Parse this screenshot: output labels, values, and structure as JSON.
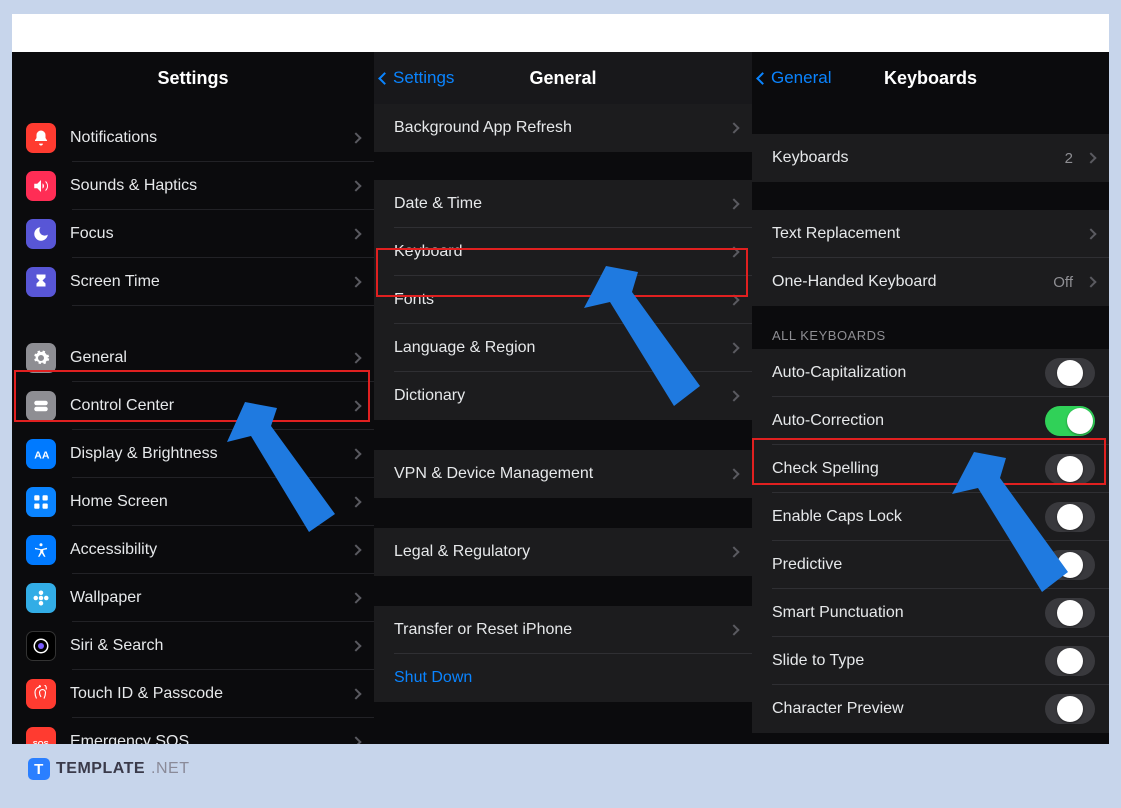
{
  "panel1": {
    "title": "Settings",
    "items_top": [
      {
        "label": "Notifications",
        "icon": "bell-icon",
        "color": "ic-red"
      },
      {
        "label": "Sounds & Haptics",
        "icon": "speaker-icon",
        "color": "ic-pink"
      },
      {
        "label": "Focus",
        "icon": "moon-icon",
        "color": "ic-indigo"
      },
      {
        "label": "Screen Time",
        "icon": "hourglass-icon",
        "color": "ic-indigo"
      }
    ],
    "items_mid": [
      {
        "label": "General",
        "icon": "gear-icon",
        "color": "ic-grey",
        "highlight": true
      },
      {
        "label": "Control Center",
        "icon": "switches-icon",
        "color": "ic-grey"
      },
      {
        "label": "Display & Brightness",
        "icon": "aa-icon",
        "color": "ic-blue"
      },
      {
        "label": "Home Screen",
        "icon": "grid-icon",
        "color": "ic-blue2"
      },
      {
        "label": "Accessibility",
        "icon": "accessibility-icon",
        "color": "ic-blue"
      },
      {
        "label": "Wallpaper",
        "icon": "flower-icon",
        "color": "ic-cyan"
      },
      {
        "label": "Siri & Search",
        "icon": "siri-icon",
        "color": "ic-black"
      },
      {
        "label": "Touch ID & Passcode",
        "icon": "fingerprint-icon",
        "color": "ic-red2"
      },
      {
        "label": "Emergency SOS",
        "icon": "sos-icon",
        "color": "ic-sos"
      }
    ]
  },
  "panel2": {
    "back": "Settings",
    "title": "General",
    "g1": [
      {
        "label": "Background App Refresh"
      }
    ],
    "g2": [
      {
        "label": "Date & Time"
      },
      {
        "label": "Keyboard",
        "highlight": true
      },
      {
        "label": "Fonts"
      },
      {
        "label": "Language & Region"
      },
      {
        "label": "Dictionary"
      }
    ],
    "g3": [
      {
        "label": "VPN & Device Management"
      }
    ],
    "g4": [
      {
        "label": "Legal & Regulatory"
      }
    ],
    "g5": [
      {
        "label": "Transfer or Reset iPhone"
      },
      {
        "label": "Shut Down",
        "shutdown": true
      }
    ]
  },
  "panel3": {
    "back": "General",
    "title": "Keyboards",
    "g1": [
      {
        "label": "Keyboards",
        "detail": "2"
      }
    ],
    "g2": [
      {
        "label": "Text Replacement"
      },
      {
        "label": "One-Handed Keyboard",
        "detail": "Off"
      }
    ],
    "section_header": "ALL KEYBOARDS",
    "toggles": [
      {
        "label": "Auto-Capitalization",
        "on": false,
        "partial": true
      },
      {
        "label": "Auto-Correction",
        "on": true,
        "highlight": true
      },
      {
        "label": "Check Spelling",
        "on": false,
        "partial": true
      },
      {
        "label": "Enable Caps Lock",
        "on": false,
        "partial": true
      },
      {
        "label": "Predictive",
        "on": false,
        "partial": true
      },
      {
        "label": "Smart Punctuation",
        "on": false,
        "partial": true
      },
      {
        "label": "Slide to Type",
        "on": false,
        "partial": true
      },
      {
        "label": "Character Preview",
        "on": false,
        "partial": true
      }
    ]
  },
  "watermark": {
    "brand": "TEMPLATE",
    "suffix": ".NET"
  }
}
